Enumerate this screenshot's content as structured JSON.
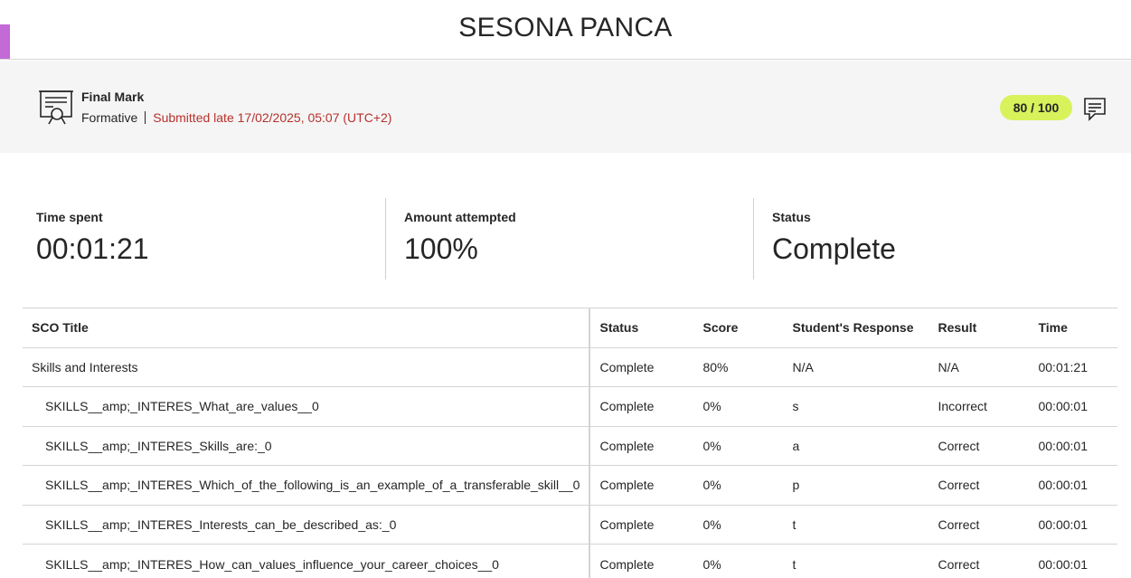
{
  "header": {
    "student_name": "SESONA PANCA",
    "accent_color": "#c36ad6"
  },
  "grade": {
    "icon": "certificate-icon",
    "title": "Final Mark",
    "type": "Formative",
    "submission_status": "Submitted late 17/02/2025, 05:07 (UTC+2)",
    "score": "80 / 100",
    "score_color": "#d7f25b",
    "late_color": "#b7312c",
    "feedback_icon": "feedback-comment-icon"
  },
  "stats": {
    "time_spent": {
      "label": "Time spent",
      "value": "00:01:21"
    },
    "amount_attempted": {
      "label": "Amount attempted",
      "value": "100%"
    },
    "status": {
      "label": "Status",
      "value": "Complete"
    }
  },
  "table": {
    "headers": {
      "title": "SCO Title",
      "status": "Status",
      "score": "Score",
      "response": "Student's Response",
      "result": "Result",
      "time": "Time"
    },
    "rows": [
      {
        "title": "Skills and Interests",
        "status": "Complete",
        "score": "80%",
        "response": "N/A",
        "result": "N/A",
        "time": "00:01:21"
      },
      {
        "title": "SKILLS__amp;_INTERES_What_are_values__0",
        "status": "Complete",
        "score": "0%",
        "response": "s",
        "result": "Incorrect",
        "time": "00:00:01"
      },
      {
        "title": "SKILLS__amp;_INTERES_Skills_are:_0",
        "status": "Complete",
        "score": "0%",
        "response": "a",
        "result": "Correct",
        "time": "00:00:01"
      },
      {
        "title": "SKILLS__amp;_INTERES_Which_of_the_following_is_an_example_of_a_transferable_skill__0",
        "status": "Complete",
        "score": "0%",
        "response": "p",
        "result": "Correct",
        "time": "00:00:01"
      },
      {
        "title": "SKILLS__amp;_INTERES_Interests_can_be_described_as:_0",
        "status": "Complete",
        "score": "0%",
        "response": "t",
        "result": "Correct",
        "time": "00:00:01"
      },
      {
        "title": "SKILLS__amp;_INTERES_How_can_values_influence_your_career_choices__0",
        "status": "Complete",
        "score": "0%",
        "response": "t",
        "result": "Correct",
        "time": "00:00:01"
      }
    ]
  }
}
